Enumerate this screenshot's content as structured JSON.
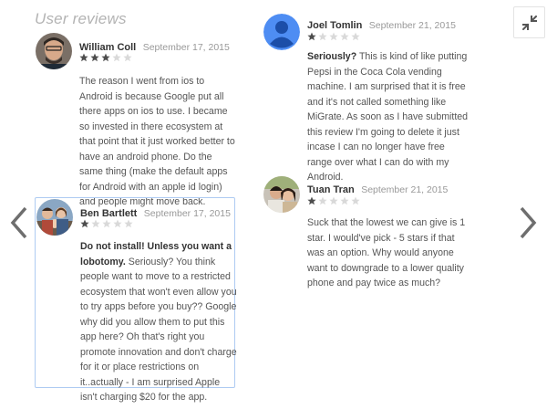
{
  "page": {
    "section_title": "User reviews"
  },
  "colors": {
    "star_filled": "#4d4d4d",
    "star_empty": "#d9d9d9",
    "highlight_border": "#aecbf2",
    "nav_arrow": "#6e6e6e",
    "default_avatar": "#4e8df3"
  },
  "reviews": [
    {
      "author": "William Coll",
      "date": "September 17, 2015",
      "rating": 3,
      "headline": "",
      "text": "The reason I went from ios to Android is because Google put all there apps on ios to use. I became so invested in there ecosystem at that point that it just worked better to have an android phone. Do the same thing (make the default apps for Android with an apple id login) and people might move back."
    },
    {
      "author": "Ben Bartlett",
      "date": "September 17, 2015",
      "rating": 1,
      "headline": "Do not install! Unless you want a lobotomy.",
      "text": "Seriously? You think people want to move to a restricted ecosystem that won't even allow you to try apps before you buy?? Google why did you allow them to put this app here? Oh that's right you promote innovation and don't charge for it or place restrictions on it..actually - I am surprised Apple isn't charging $20 for the app."
    },
    {
      "author": "Joel Tomlin",
      "date": "September 21, 2015",
      "rating": 1,
      "headline": "Seriously?",
      "text": "This is kind of like putting Pepsi in the Coca Cola vending machine. I am surprised that it is free and it's not called something like MiGrate. As soon as I have submitted this review I'm going to delete it just incase I can no longer have free range over what I can do with my Android."
    },
    {
      "author": "Tuan Tran",
      "date": "September 21, 2015",
      "rating": 1,
      "headline": "",
      "text": "Suck that the lowest we can give is 1 star. I would've pick - 5 stars if that was an option. Why would anyone want to downgrade to a lower quality phone and pay twice as much?"
    }
  ]
}
